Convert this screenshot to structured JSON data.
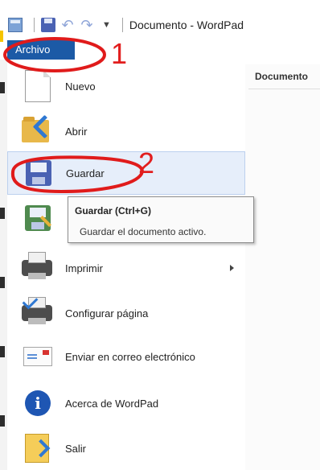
{
  "window": {
    "title": "Documento - WordPad"
  },
  "file_tab": {
    "label": "Archivo"
  },
  "menu": {
    "items": [
      {
        "label": "Nuevo",
        "icon": "new-document-icon"
      },
      {
        "label": "Abrir",
        "icon": "open-folder-icon"
      },
      {
        "label": "Guardar",
        "icon": "save-floppy-icon"
      },
      {
        "label": "",
        "icon": "save-as-icon"
      },
      {
        "label": "Imprimir",
        "icon": "printer-icon"
      },
      {
        "label": "Configurar página",
        "icon": "page-setup-icon"
      },
      {
        "label": "Enviar en correo electrónico",
        "icon": "email-icon"
      },
      {
        "label": "Acerca de WordPad",
        "icon": "info-icon"
      },
      {
        "label": "Salir",
        "icon": "exit-icon"
      }
    ]
  },
  "right_pane": {
    "header": "Documento"
  },
  "tooltip": {
    "title": "Guardar (Ctrl+G)",
    "description": "Guardar el documento activo."
  },
  "annotations": {
    "step1": "1",
    "step2": "2",
    "color": "#e21e1e"
  },
  "colors": {
    "file_tab": "#1c5aa6",
    "hover": "#e6eefa"
  }
}
